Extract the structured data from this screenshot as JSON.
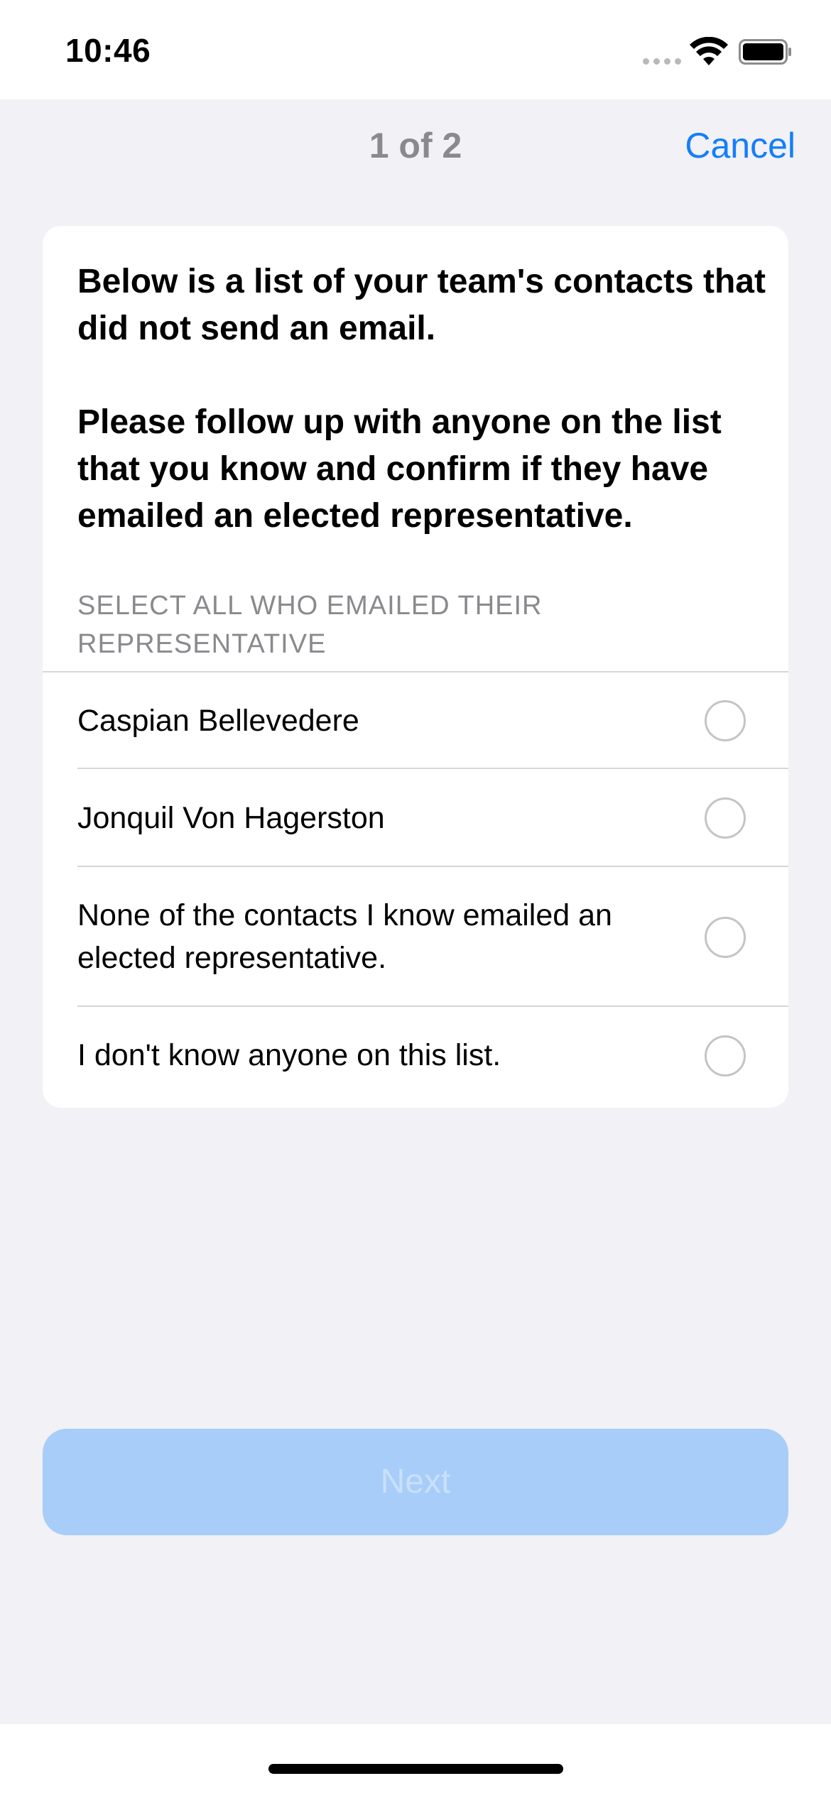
{
  "status_bar": {
    "time": "10:46",
    "icons": [
      "signal-dots-icon",
      "wifi-icon",
      "battery-icon"
    ]
  },
  "nav": {
    "title": "1 of 2",
    "cancel_label": "Cancel"
  },
  "intro": {
    "line1": "Below is a list of your team's contacts that did not send an email.",
    "line2": "Please follow up with anyone on the list that you know and confirm if they have emailed an elected representative."
  },
  "section_header": "SELECT ALL WHO EMAILED THEIR REPRESENTATIVE",
  "options": [
    {
      "label": "Caspian Bellevedere",
      "selected": false
    },
    {
      "label": "Jonquil Von Hagerston",
      "selected": false
    },
    {
      "label": "None of the contacts I know emailed an elected representative.",
      "selected": false
    },
    {
      "label": "I don't know anyone on this list.",
      "selected": false
    }
  ],
  "next_button": {
    "label": "Next",
    "enabled": false
  },
  "colors": {
    "accent": "#147efb",
    "background": "#f1f1f6",
    "card": "#ffffff",
    "button_disabled": "#a8cdf8",
    "secondary_text": "#8a8a8e"
  }
}
